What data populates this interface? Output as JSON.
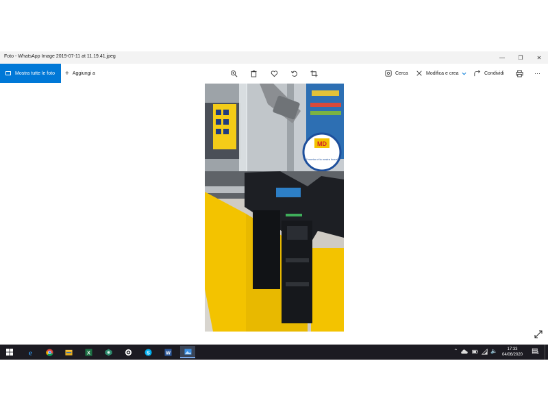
{
  "window": {
    "title": "Foto - WhatsApp Image 2019-07-11 at 11.19.41.jpeg",
    "controls": {
      "minimize": "—",
      "maximize": "❐",
      "close": "✕"
    }
  },
  "toolbar": {
    "show_all_label": "Mostra tutte le foto",
    "add_to_label": "Aggiungi a",
    "add_glyph": "+",
    "search_label": "Cerca",
    "edit_create_label": "Modifica e crea",
    "share_label": "Condividi",
    "more_glyph": "···",
    "center_icons": [
      "zoom-in-icon",
      "delete-icon",
      "favorite-icon",
      "rotate-icon",
      "crop-icon"
    ]
  },
  "photo": {
    "sign_brand": "MD",
    "sign_text": "Il sorriso è la nostra forza!",
    "colors": {
      "counter_yellow": "#f3c300",
      "machine_dark": "#1d1f24"
    }
  },
  "taskbar": {
    "apps": [
      "start-icon",
      "edge-icon",
      "chrome-icon",
      "file-explorer-icon",
      "excel-icon",
      "app-icon",
      "settings-app-icon",
      "skype-icon",
      "word-icon",
      "photos-icon"
    ],
    "tray_glyphs": {
      "chevron": "⌃",
      "volume": "🔈",
      "notifications": "▤"
    },
    "time": "17:33",
    "date": "04/06/2020",
    "notification_count": "1"
  }
}
